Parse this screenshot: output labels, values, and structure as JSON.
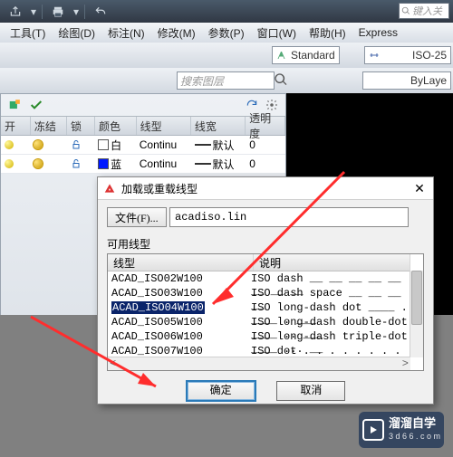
{
  "menu": {
    "tools": "工具(T)",
    "draw": "绘图(D)",
    "dim": "标注(N)",
    "modify": "修改(M)",
    "param": "参数(P)",
    "window": "窗口(W)",
    "help": "帮助(H)",
    "express": "Express"
  },
  "find_placeholder": "键入关",
  "ribbon": {
    "style": "Standard",
    "dimstyle": "ISO-25",
    "linetype": "ByLaye"
  },
  "layer_search_placeholder": "搜索图层",
  "layer_headers": {
    "on": "开",
    "freeze": "冻结",
    "lock": "锁",
    "color": "颜色",
    "linetype": "线型",
    "lineweight": "线宽",
    "transparency": "透明度"
  },
  "layers": [
    {
      "color": "白",
      "swatch": "#ffffff",
      "lt": "Continu",
      "lw": "默认",
      "tr": "0"
    },
    {
      "color": "蓝",
      "swatch": "#0018ff",
      "lt": "Continu",
      "lw": "默认",
      "tr": "0"
    }
  ],
  "dialog": {
    "title": "加载或重载线型",
    "file_btn": "文件(F)...",
    "filename": "acadiso.lin",
    "group": "可用线型",
    "col_lt": "线型",
    "col_desc": "说明",
    "items": [
      {
        "name": "ACAD_ISO02W100",
        "desc": "ISO dash __ __ __ __ __ __ __ __"
      },
      {
        "name": "ACAD_ISO03W100",
        "desc": "ISO dash space __   __   __   __"
      },
      {
        "name": "ACAD_ISO04W100",
        "desc": "ISO long-dash dot ____ . ____ . ___"
      },
      {
        "name": "ACAD_ISO05W100",
        "desc": "ISO long-dash double-dot ____ .. ___"
      },
      {
        "name": "ACAD_ISO06W100",
        "desc": "ISO long-dash triple-dot ____ ... __"
      },
      {
        "name": "ACAD_ISO07W100",
        "desc": "ISO dot . . . . . . . . . . . . . ."
      }
    ],
    "ok": "确定",
    "cancel": "取消"
  },
  "logo": {
    "name": "溜溜自学",
    "sub": "3 d 6 6 . c o m"
  }
}
